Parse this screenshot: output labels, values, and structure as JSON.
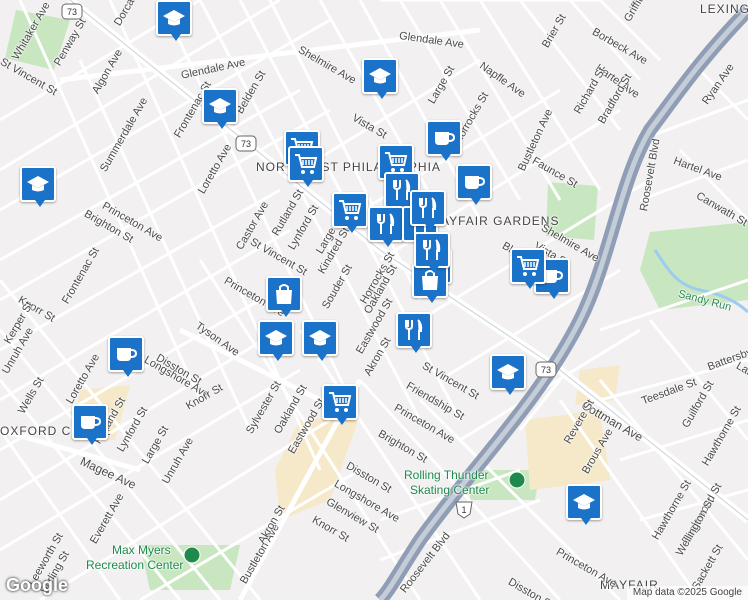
{
  "map": {
    "attribution": "Map data ©2025 Google",
    "brand": "Google",
    "areas": {
      "northeast_philadelphia": "NORTHEAST PHILADELPHIA",
      "mayfair_gardens": "MAYFAIR GARDENS",
      "oxford_circle": "OXFORD CIRCLE",
      "lexington_park": "LEXINGTON PARK",
      "mayfair": "MAYFAIR"
    },
    "pois": {
      "rolling_thunder_line1": "Rolling Thunder",
      "rolling_thunder_line2": "Skating Center",
      "max_myers_line1": "Max Myers",
      "max_myers_line2": "Recreation Center",
      "sandy_run": "Sandy Run"
    },
    "route_number": "73",
    "interstate_number": "1",
    "streets": {
      "glendale_ave": "Glendale Ave",
      "glendale_ave_2": "Glendale Ave",
      "napfle_ave": "Napfle Ave",
      "hartel_ave": "Hartel Ave",
      "hartel_ave_2": "Hartel Ave",
      "ryan_ave": "Ryan Ave",
      "roosevelt_blvd": "Roosevelt Blvd",
      "roosevelt_blvd_2": "Roosevelt Blvd",
      "cottman_ave": "Cottman Ave",
      "tyson_ave": "Tyson Ave",
      "bustleton_ave": "Bustleton Ave",
      "bustleton_ave_2": "Bustleton Ave",
      "shelmire_ave": "Shelmire Ave",
      "shelmire_ave_2": "Shelmire Ave",
      "vista_st": "Vista St",
      "vista_st_2": "Vista St",
      "large_st": "Large St",
      "large_st_2": "Large St",
      "large_st_3": "Large St",
      "horrocks_st": "Horrocks St",
      "horrocks_st_2": "Horrocks St",
      "faunce_st": "Faunce St",
      "brier_st": "Brier St",
      "borbeck_ave": "Borbeck Ave",
      "griffith_st": "Griffith St",
      "richard_st": "Richard St",
      "bradford_st": "Bradford St",
      "canwath_st": "Canwath St",
      "castor_ave": "Castor Ave",
      "rutland_st": "Rutland St",
      "rutland_st_2": "Rutland St",
      "lynford_st": "Lynford St",
      "lynford_st_2": "Lynford St",
      "st_vincent_st": "St Vincent St",
      "st_vincent_st_2": "St Vincent St",
      "st_vincent_st_3": "St Vincent St",
      "kindred_st": "Kindred St",
      "souder_st": "Souder St",
      "oakland_st": "Oakland St",
      "oakland_st_2": "Oakland St",
      "eastwood_st": "Eastwood St",
      "eastwood_st_2": "Eastwood St",
      "akron_st": "Akron St",
      "akron_st_2": "Akron St",
      "princeton_ave": "Princeton Ave",
      "princeton_ave_2": "Princeton Ave",
      "princeton_ave_3": "Princeton Ave",
      "princeton_ave_4": "Princeton Ave",
      "brighton_st": "Brighton St",
      "brighton_st_2": "Brighton St",
      "disston_st": "Disston St",
      "disston_st_2": "Disston St",
      "disston_st_3": "Disston St",
      "longshore_ave": "Longshore Ave",
      "longshore_ave_2": "Longshore Ave",
      "knorr_st": "Knorr St",
      "knorr_st_2": "Knorr St",
      "knorr_st_3": "Knorr St",
      "magee_ave": "Magee Ave",
      "glenview_st": "Glenview St",
      "friendship_st": "Friendship St",
      "frontenac_st": "Frontenac St",
      "frontenac_st_2": "Frontenac St",
      "loretto_ave": "Loretto Ave",
      "loretto_ave_2": "Loretto Ave",
      "summerdale_ave": "Summerdale Ave",
      "algon_ave": "Algon Ave",
      "penway_st": "Penway St",
      "whitaker_ave": "Whitaker Ave",
      "dorcas_st": "Dorcas St",
      "belden_st": "Belden St",
      "kerper_st": "Kerper St",
      "unruh_ave": "Unruh Ave",
      "unruh_ave_2": "Unruh Ave",
      "wells_st": "Wells St",
      "everett_ave": "Everett Ave",
      "leeworth_st": "Leeworth St",
      "stirling_st": "Stirling St",
      "sylvester_st": "Sylvester St",
      "revere_st": "Revere St",
      "brous_ave": "Brous Ave",
      "teesdale_st": "Teesdale St",
      "guilford_st": "Guilford St",
      "hawthorne_st": "Hawthorne St",
      "hawthorne_st_2": "Hawthorne St",
      "englewood_st": "Englewood St",
      "wellington_st": "Wellington St",
      "sackett_st": "Sackett St",
      "battersby": "Battersby",
      "bleigh": "Bleigh",
      "lardner": "Larc"
    },
    "markers": [
      {
        "type": "school",
        "icon": "school-icon"
      },
      {
        "type": "school",
        "icon": "school-icon"
      },
      {
        "type": "school",
        "icon": "school-icon"
      },
      {
        "type": "school",
        "icon": "school-icon"
      },
      {
        "type": "school",
        "icon": "school-icon"
      },
      {
        "type": "school",
        "icon": "school-icon"
      },
      {
        "type": "school",
        "icon": "school-icon"
      },
      {
        "type": "school",
        "icon": "school-icon"
      },
      {
        "type": "cafe",
        "icon": "coffee-cup-icon"
      },
      {
        "type": "cafe",
        "icon": "coffee-cup-icon"
      },
      {
        "type": "cafe",
        "icon": "coffee-cup-icon"
      },
      {
        "type": "cafe",
        "icon": "coffee-cup-icon"
      },
      {
        "type": "cafe",
        "icon": "coffee-cup-icon"
      },
      {
        "type": "grocery",
        "icon": "shopping-cart-icon"
      },
      {
        "type": "grocery",
        "icon": "shopping-cart-icon"
      },
      {
        "type": "grocery",
        "icon": "shopping-cart-icon"
      },
      {
        "type": "grocery",
        "icon": "shopping-cart-icon"
      },
      {
        "type": "grocery",
        "icon": "shopping-cart-icon"
      },
      {
        "type": "grocery",
        "icon": "shopping-cart-icon"
      },
      {
        "type": "grocery",
        "icon": "shopping-cart-icon"
      },
      {
        "type": "store",
        "icon": "shopping-bag-icon"
      },
      {
        "type": "store",
        "icon": "shopping-bag-icon"
      },
      {
        "type": "restaurant",
        "icon": "fork-knife-icon"
      },
      {
        "type": "restaurant",
        "icon": "fork-knife-icon"
      },
      {
        "type": "restaurant",
        "icon": "fork-knife-icon"
      },
      {
        "type": "restaurant",
        "icon": "fork-knife-icon"
      },
      {
        "type": "restaurant",
        "icon": "fork-knife-icon"
      },
      {
        "type": "restaurant",
        "icon": "fork-knife-icon"
      }
    ],
    "colors": {
      "background": "#f2f0f0",
      "road": "#ffffff",
      "highway": "#8f9eb5",
      "park": "#c8e6c0",
      "water": "#9ecbf0",
      "commercial": "#f6e9c9",
      "marker": "#1a72c9"
    }
  }
}
